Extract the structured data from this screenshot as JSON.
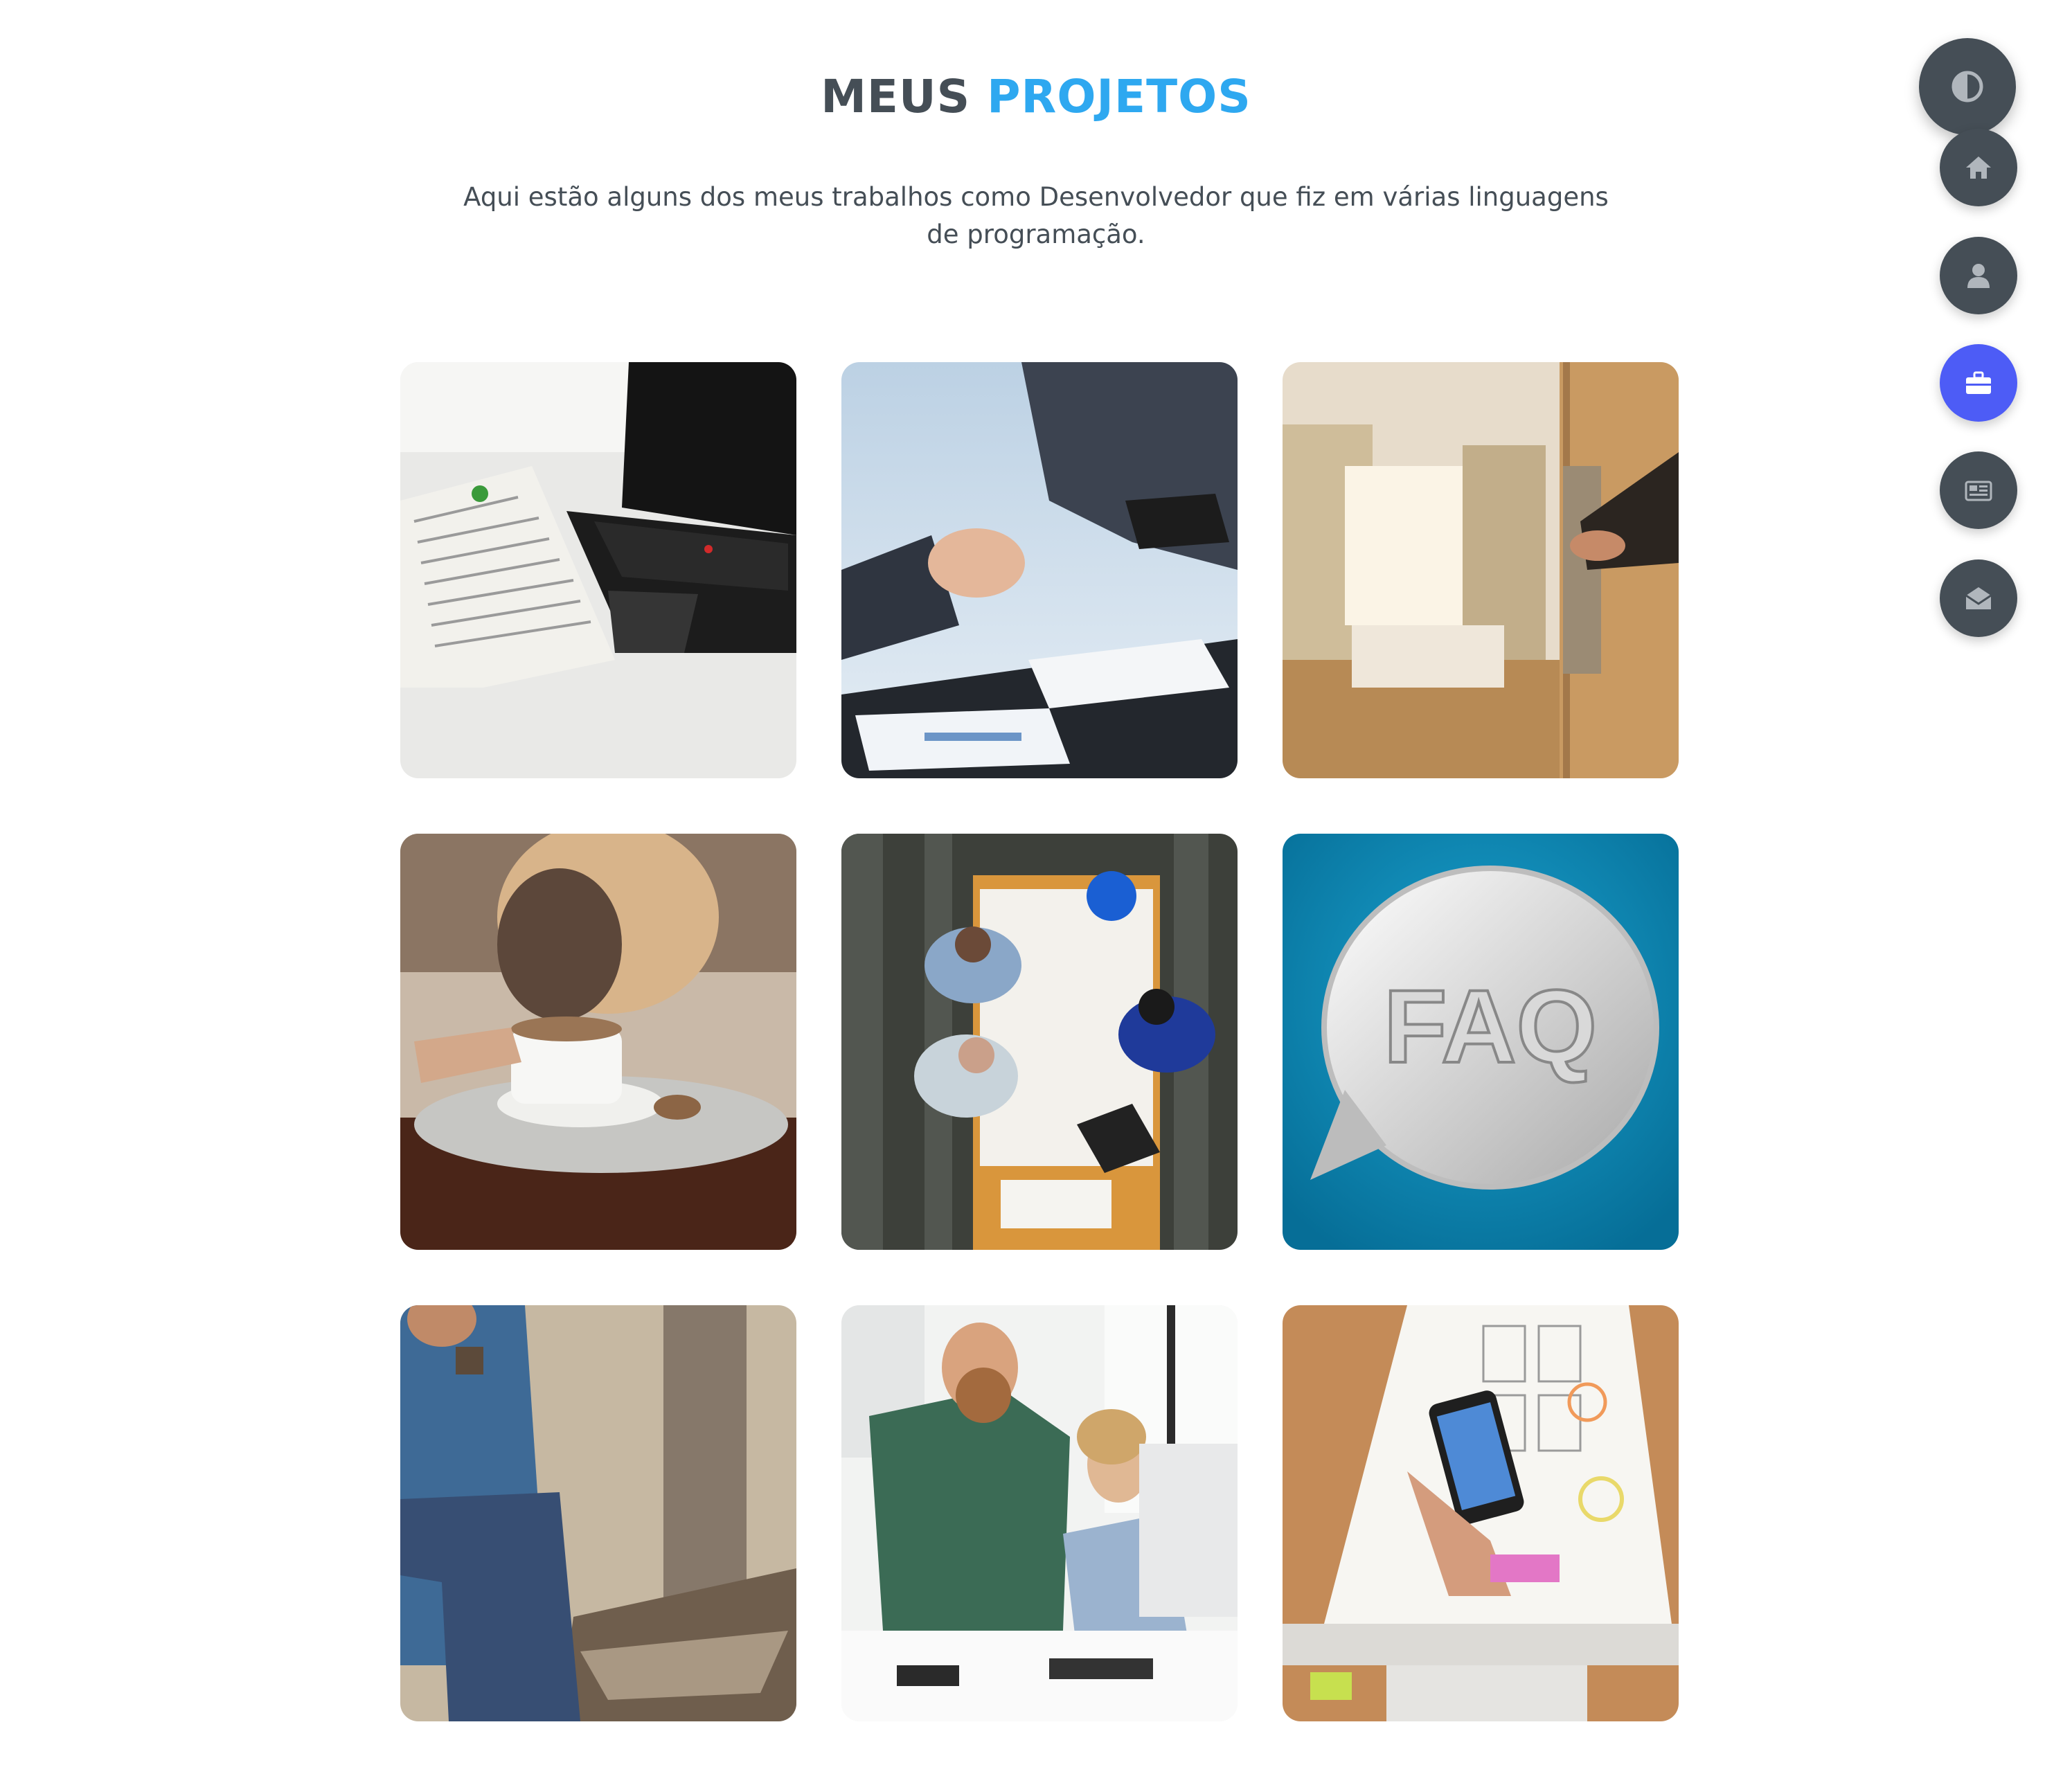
{
  "section": {
    "title_part1": "MEUS",
    "title_part2": "PROJETOS",
    "description": "Aqui estão alguns dos meus trabalhos como Desenvolvedor que fiz em várias linguagens de programação."
  },
  "projects": [
    {
      "image": "laptop-newspaper"
    },
    {
      "image": "business-handshake"
    },
    {
      "image": "hotel-room-door"
    },
    {
      "image": "coffee-cup"
    },
    {
      "image": "team-meeting-blueprints"
    },
    {
      "image": "faq-speech-bubble"
    },
    {
      "image": "man-sitting-outdoors"
    },
    {
      "image": "coworkers-at-desk"
    },
    {
      "image": "smartphone-wireframes"
    }
  ],
  "nav": {
    "theme_toggle_icon": "contrast-icon",
    "items": [
      {
        "icon": "home-icon",
        "active": false
      },
      {
        "icon": "user-icon",
        "active": false
      },
      {
        "icon": "briefcase-icon",
        "active": true
      },
      {
        "icon": "newspaper-icon",
        "active": false
      },
      {
        "icon": "envelope-open-icon",
        "active": false
      }
    ]
  },
  "colors": {
    "heading_dark": "#454e56",
    "heading_accent": "#2ea8f0",
    "nav_bg": "#454e56",
    "nav_active": "#4d5cf6"
  }
}
